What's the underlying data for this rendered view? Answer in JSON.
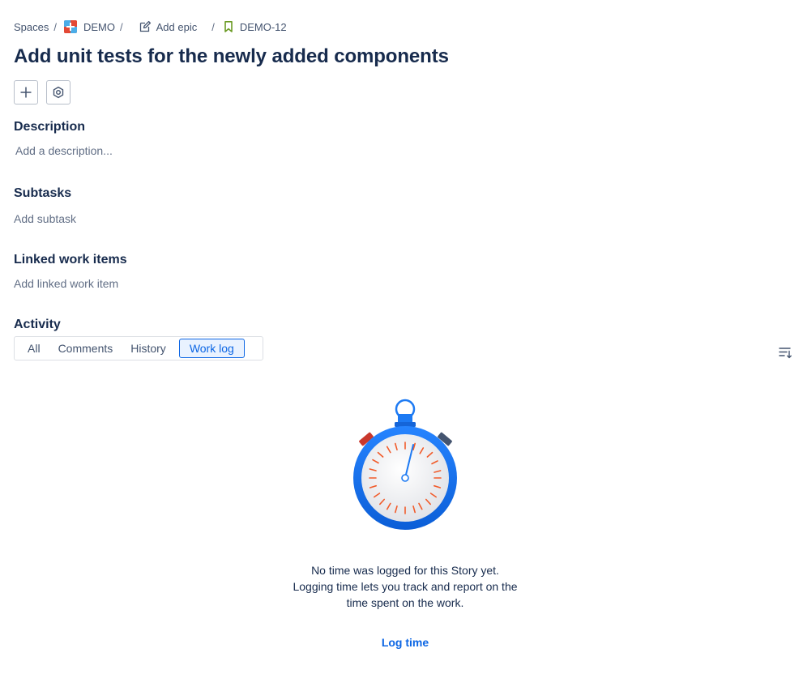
{
  "breadcrumb": {
    "spaces": "Spaces",
    "project": "DEMO",
    "epic": "Add epic",
    "issue_key": "DEMO-12",
    "separator": "/"
  },
  "title": "Add unit tests for the newly added components",
  "actions": {
    "add_icon": "plus-icon",
    "apps_icon": "hexagon-icon"
  },
  "description": {
    "heading": "Description",
    "placeholder": "Add a description..."
  },
  "subtasks": {
    "heading": "Subtasks",
    "placeholder": "Add subtask"
  },
  "linked": {
    "heading": "Linked work items",
    "placeholder": "Add linked work item"
  },
  "activity": {
    "heading": "Activity",
    "tabs": [
      "All",
      "Comments",
      "History",
      "Work log"
    ],
    "active_tab": "Work log"
  },
  "empty_state": {
    "illustration": "stopwatch-illustration",
    "line1": "No time was logged for this Story yet.",
    "line2": "Logging time lets you track and report on the",
    "line3": "time spent on the work.",
    "action": "Log time"
  },
  "colors": {
    "primary": "#0c66e4",
    "text": "#172b4d",
    "subtle": "#626f86",
    "stopwatch_ring": "#1d7af3",
    "tick_marks": "#f15b2a"
  }
}
